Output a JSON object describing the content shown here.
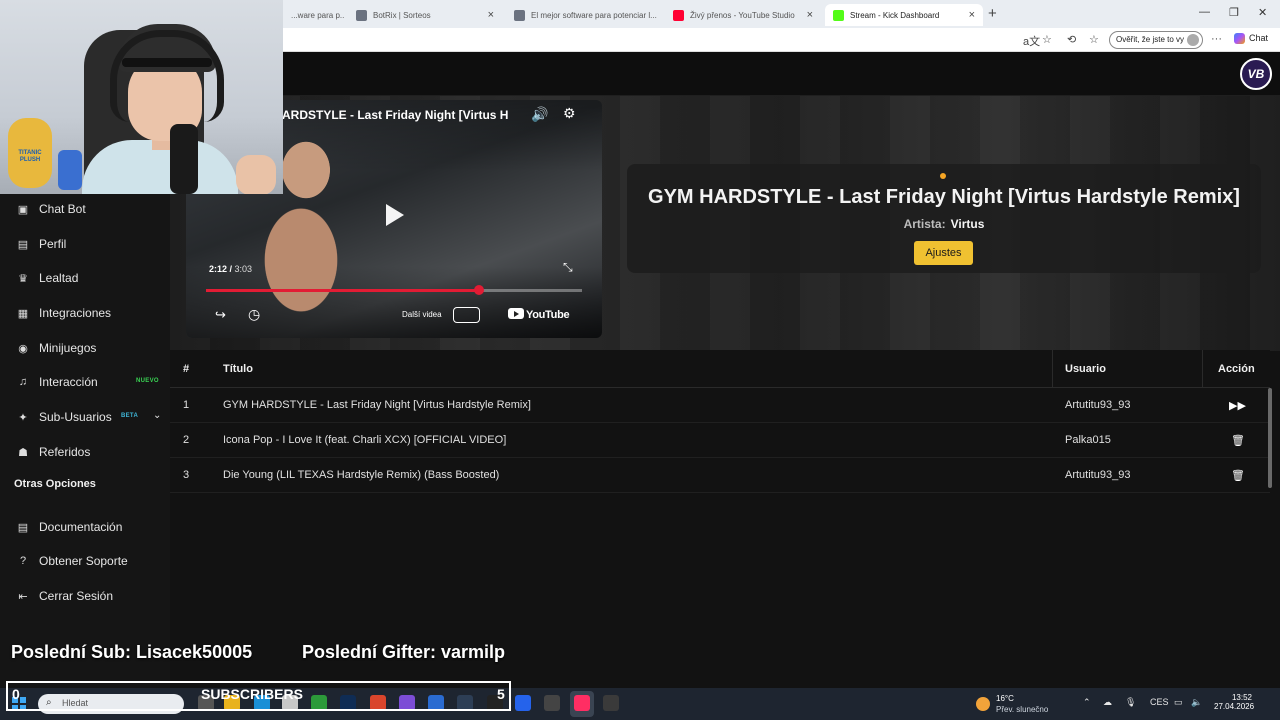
{
  "browser": {
    "tabs": [
      {
        "label": "...ware para p...",
        "favicon_color": "#6b7280"
      },
      {
        "label": "BotRix | Sorteos",
        "favicon_color": "#6b7280"
      },
      {
        "label": "El mejor software para potenciar l...",
        "favicon_color": "#6b7280"
      },
      {
        "label": "Živý přenos - YouTube Studio",
        "favicon_color": "#ff0033"
      },
      {
        "label": "Stream - Kick Dashboard",
        "favicon_color": "#53fc18",
        "active": true
      }
    ],
    "verify_button": "Ověřit, že jste to vy",
    "chat_label": "Chat"
  },
  "app": {
    "logo_text": "VB",
    "sidebar": {
      "items": [
        {
          "label": "Chat Bot",
          "icon": "robot-icon"
        },
        {
          "label": "Perfil",
          "icon": "id-card-icon"
        },
        {
          "label": "Lealtad",
          "icon": "trophy-icon"
        },
        {
          "label": "Integraciones",
          "icon": "plug-icon"
        },
        {
          "label": "Minijuegos",
          "icon": "gamepad-icon"
        },
        {
          "label": "Interacción",
          "icon": "music-icon",
          "badge": "NUEVO",
          "badge_color": "#39d353"
        },
        {
          "label": "Sub-Usuarios",
          "icon": "users-icon",
          "badge": "BETA",
          "badge_color": "#3fb6d8",
          "chevron": true
        },
        {
          "label": "Referidos",
          "icon": "user-group-icon"
        }
      ],
      "section_label": "Otras Opciones",
      "other_items": [
        {
          "label": "Documentación",
          "icon": "document-icon"
        },
        {
          "label": "Obtener Soporte",
          "icon": "help-icon"
        },
        {
          "label": "Cerrar Sesión",
          "icon": "logout-icon"
        }
      ]
    },
    "player": {
      "title": "ARDSTYLE - Last Friday Night [Virtus H",
      "time_current": "2:12",
      "time_total": "3:03",
      "progress": 0.725,
      "more_videos_label": "Další videa",
      "brand_label": "YouTube"
    },
    "now_playing": {
      "title": "GYM HARDSTYLE - Last Friday Night [Virtus Hardstyle Remix]",
      "artist_label": "Artista:",
      "artist": "Virtus",
      "settings_button": "Ajustes",
      "accent_color": "#f0c131"
    },
    "queue": {
      "headers": {
        "num": "#",
        "title": "Título",
        "user": "Usuario",
        "action": "Acción"
      },
      "rows": [
        {
          "num": "1",
          "title": "GYM HARDSTYLE - Last Friday Night [Virtus Hardstyle Remix]",
          "user": "Artutitu93_93",
          "action_icon": "skip-forward-icon"
        },
        {
          "num": "2",
          "title": "Icona Pop - I Love It (feat. Charli XCX) [OFFICIAL VIDEO]",
          "user": "Palka015",
          "action_icon": "trash-icon"
        },
        {
          "num": "3",
          "title": "Die Young (LIL TEXAS Hardstyle Remix) (Bass Boosted)",
          "user": "Artutitu93_93",
          "action_icon": "trash-icon"
        }
      ]
    }
  },
  "stream_overlay": {
    "last_sub": "Poslední Sub: Lisacek50005",
    "last_gifter": "Poslední Gifter: varmilp",
    "subs_left": "0",
    "subs_label": "SUBSCRIBERS",
    "subs_right": "5",
    "webcam_plush_label": "TITANIC PLUSH"
  },
  "taskbar": {
    "search_placeholder": "Hledat",
    "weather_temp": "16°C",
    "weather_desc": "Přev. slunečno",
    "language": "CES",
    "time": "13:52",
    "date": "27.04.2026"
  }
}
